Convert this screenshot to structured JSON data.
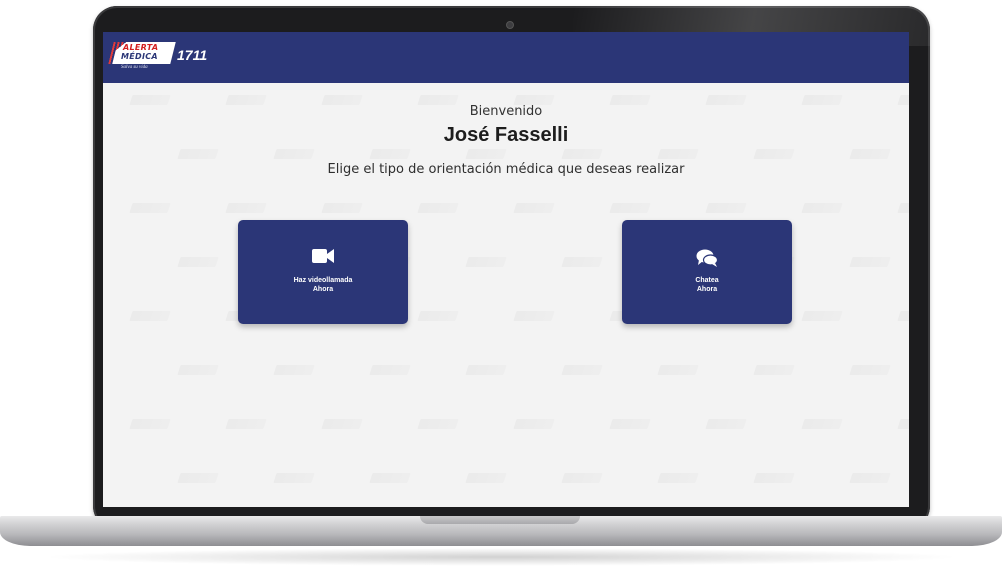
{
  "app": {
    "logo": {
      "line1": "ALERTA",
      "line2": "MÉDICA",
      "number": "1711",
      "tagline": "Salva su vida"
    }
  },
  "main": {
    "welcome": "Bienvenido",
    "user_name": "José Fasselli",
    "subtitle": "Elige el tipo de orientación médica que deseas realizar"
  },
  "options": {
    "video": {
      "icon": "video-camera-icon",
      "label_line1": "Haz videollamada",
      "label_line2": "Ahora"
    },
    "chat": {
      "icon": "chat-bubbles-icon",
      "label_line1": "Chatea",
      "label_line2": "Ahora"
    }
  },
  "colors": {
    "brand_primary": "#2b3677",
    "logo_red": "#d32020",
    "page_background": "#f3f3f3"
  }
}
